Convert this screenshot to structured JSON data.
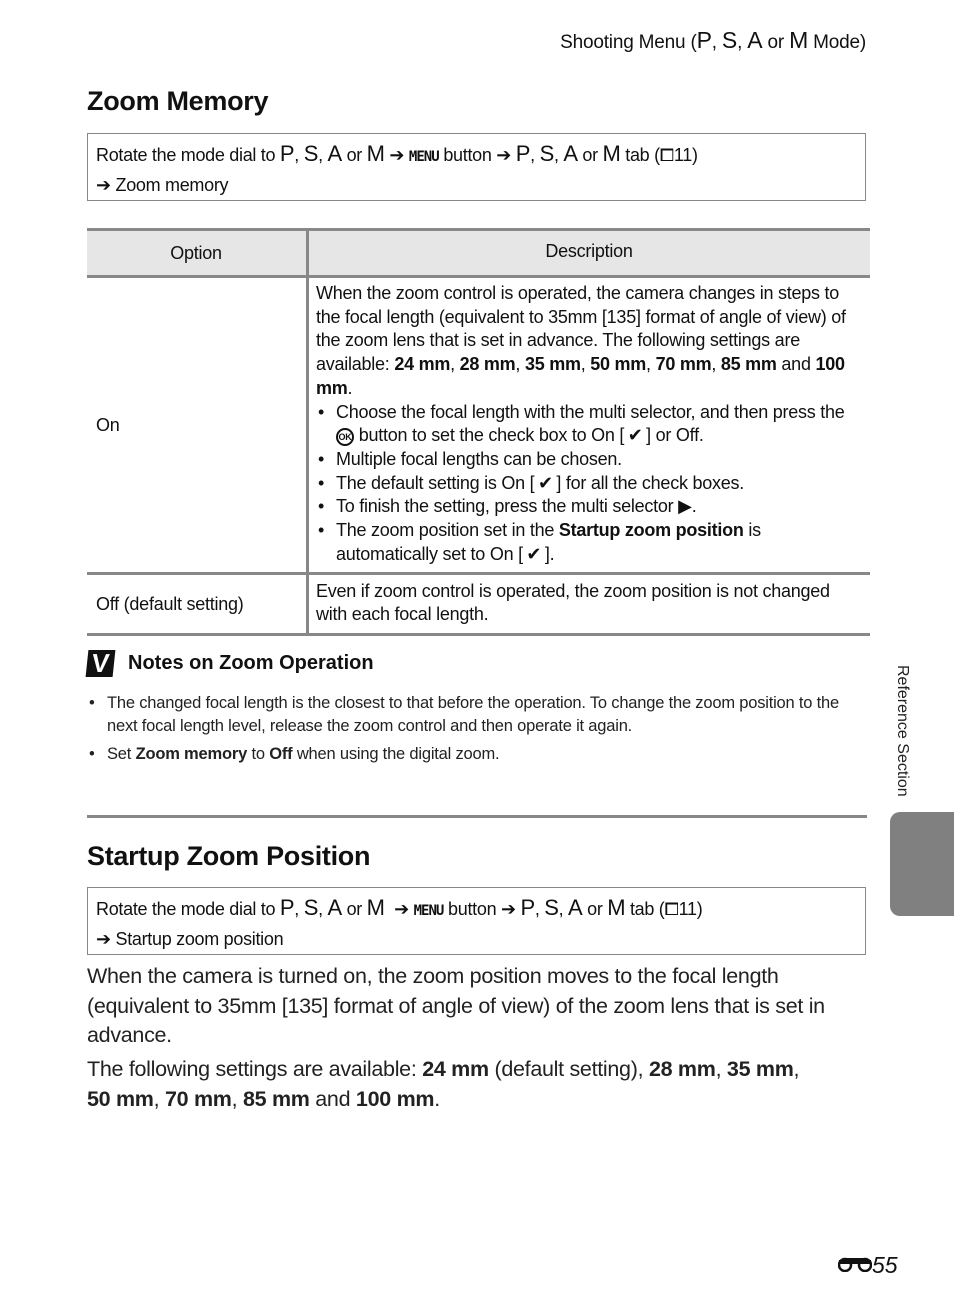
{
  "running_head": {
    "prefix": "Shooting Menu (",
    "modes": [
      "P",
      "S",
      "A",
      "M"
    ],
    "or": "or",
    "suffix": "Mode)"
  },
  "sections": {
    "zoom_memory": {
      "title": "Zoom Memory",
      "path": {
        "lead": "Rotate the mode dial to",
        "menu": "MENU",
        "button": "button",
        "tab": "tab (",
        "page_ref": "11)",
        "end": "Zoom memory"
      },
      "table": {
        "headers": [
          "Option",
          "Description"
        ],
        "rows": [
          {
            "option": "On",
            "intro_pre": "When the zoom control is operated, the camera changes in steps to the focal length (equivalent to 35mm [135] format of angle of view) of the zoom lens that is set in advance. The following settings are available: ",
            "lengths": [
              "24 mm",
              "28 mm",
              "35 mm",
              "50 mm",
              "70 mm",
              "85 mm",
              "100 mm"
            ],
            "bullets": [
              {
                "a": "Choose the focal length with the multi selector, and then press the ",
                "b": " button to set the check box to On [",
                "c": "] or Off."
              },
              {
                "a": "Multiple focal lengths can be chosen."
              },
              {
                "a": "The default setting is On [",
                "c": "] for all the check boxes."
              },
              {
                "a": "To finish the setting, press the multi selector "
              },
              {
                "a": "The zoom position set in the ",
                "bold": "Startup zoom position",
                "c": " is automatically set to On ["
              }
            ]
          },
          {
            "option": "Off (default setting)",
            "desc": "Even if zoom control is operated, the zoom position is not changed with each focal length."
          }
        ]
      },
      "notes": {
        "title": "Notes on Zoom Operation",
        "items": [
          "The changed focal length is the closest to that before the operation. To change the zoom position to the next focal length level, release the zoom control and then operate it again.",
          {
            "a": "Set ",
            "b": "Zoom memory",
            "c": " to ",
            "d": "Off",
            "e": " when using the digital zoom."
          }
        ]
      }
    },
    "startup_zoom": {
      "title": "Startup Zoom Position",
      "path": {
        "lead": "Rotate the mode dial to",
        "menu": "MENU",
        "button": "button",
        "tab": "tab (",
        "page_ref": "11)",
        "end": "Startup zoom position"
      },
      "para1": "When the camera is turned on, the zoom position moves to the focal length (equivalent to 35mm [135] format of angle of view) of the zoom lens that is set in advance.",
      "para2_lead": "The following settings are available: ",
      "para2_default": " (default setting), ",
      "lengths": [
        "24 mm",
        "28 mm",
        "35 mm",
        "50 mm",
        "70 mm",
        "85 mm",
        "100 mm"
      ]
    }
  },
  "side": {
    "label": "Reference Section"
  },
  "page_number": "55",
  "glyphs": {
    "check": "✔",
    "arrow": "➔",
    "triangle": "▶",
    "ok": "OK",
    "book": "⧠"
  }
}
